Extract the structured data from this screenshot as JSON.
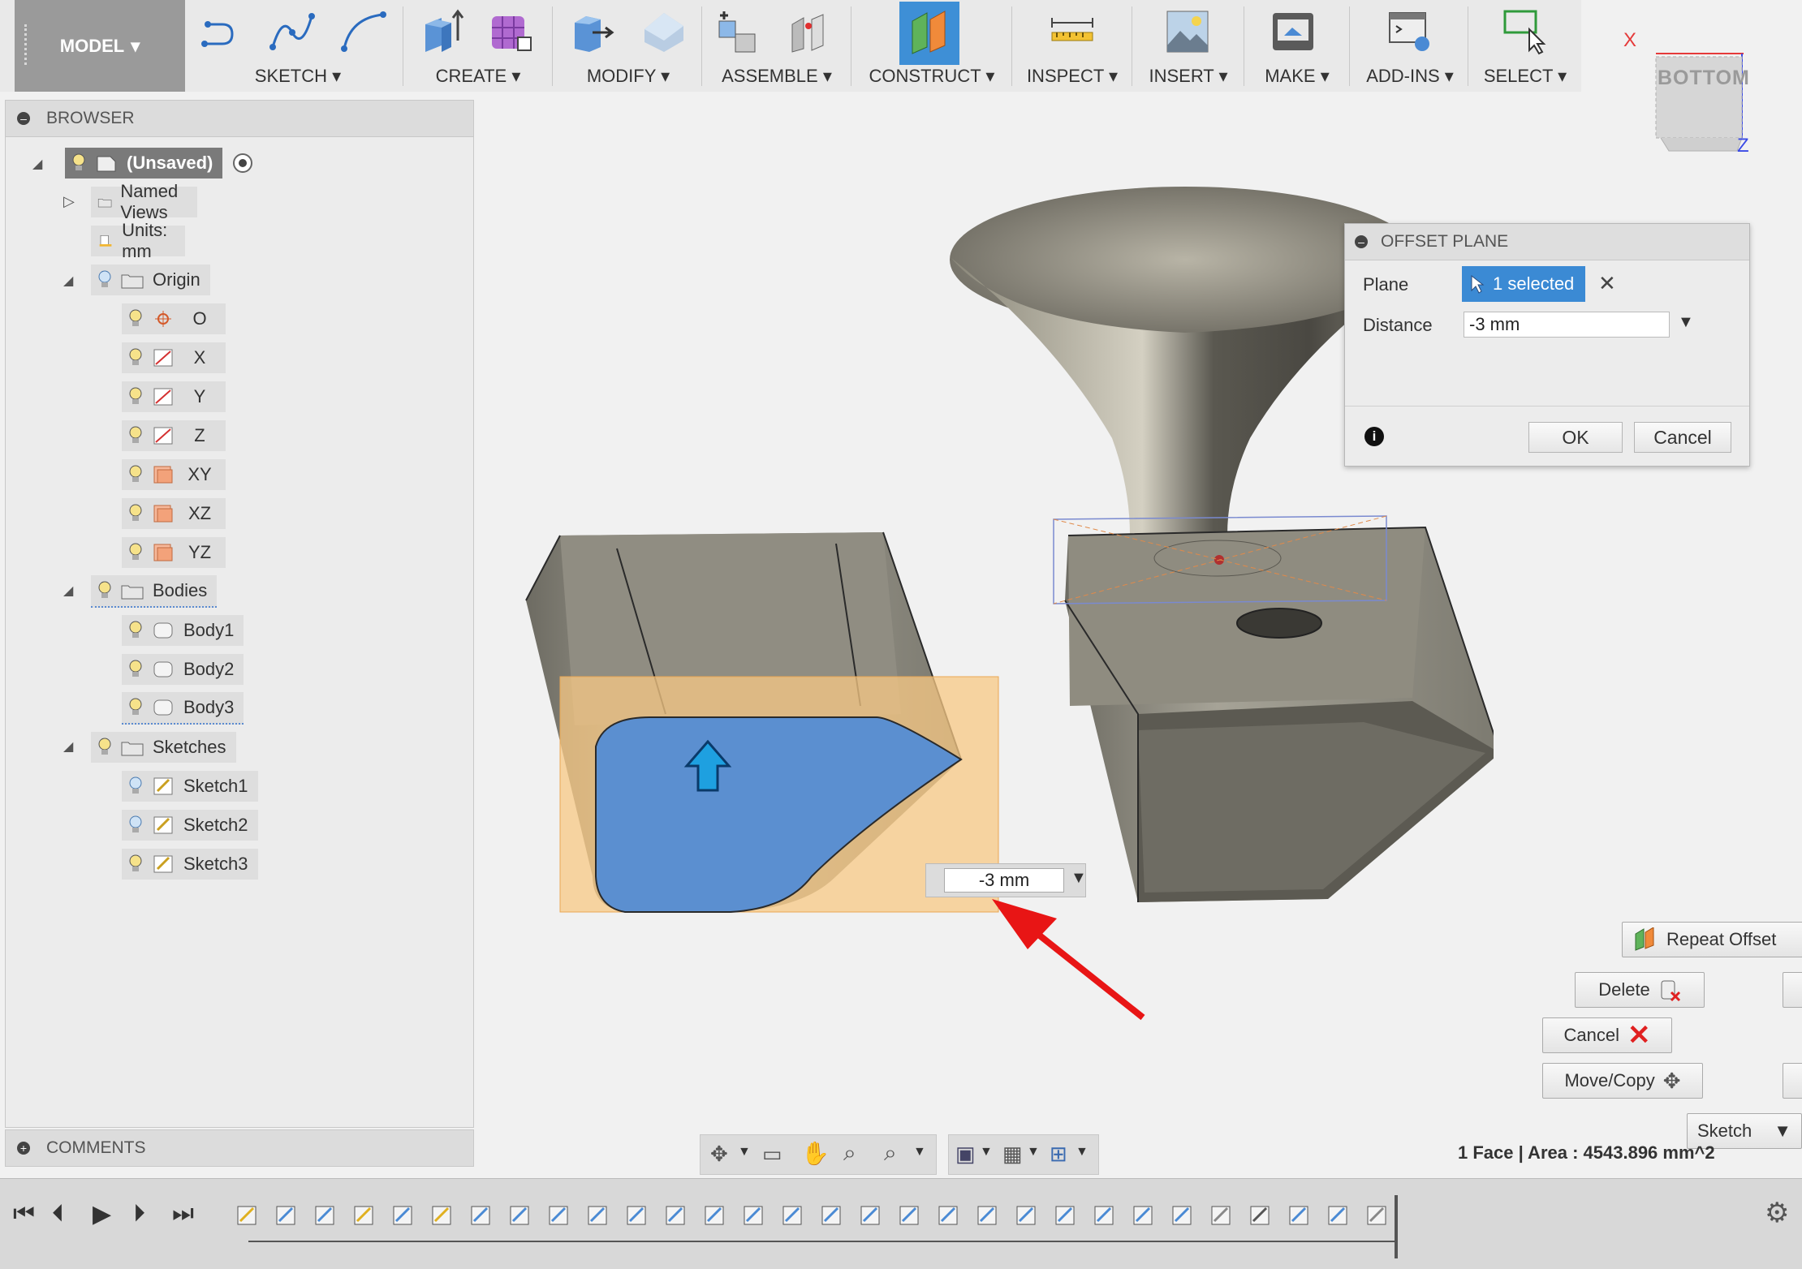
{
  "toolbar": {
    "model_label": "MODEL",
    "groups": [
      {
        "label": "SKETCH"
      },
      {
        "label": "CREATE"
      },
      {
        "label": "MODIFY"
      },
      {
        "label": "ASSEMBLE"
      },
      {
        "label": "CONSTRUCT"
      },
      {
        "label": "INSPECT"
      },
      {
        "label": "INSERT"
      },
      {
        "label": "MAKE"
      },
      {
        "label": "ADD-INS"
      },
      {
        "label": "SELECT"
      }
    ]
  },
  "viewcube": {
    "face": "BOTTOM",
    "axis_x": "X",
    "axis_z": "Z"
  },
  "browser": {
    "title": "BROWSER",
    "root": "(Unsaved)",
    "named_views": "Named Views",
    "units": "Units: mm",
    "origin": {
      "label": "Origin",
      "items": [
        "O",
        "X",
        "Y",
        "Z",
        "XY",
        "XZ",
        "YZ"
      ]
    },
    "bodies": {
      "label": "Bodies",
      "items": [
        "Body1",
        "Body2",
        "Body3"
      ]
    },
    "sketches": {
      "label": "Sketches",
      "items": [
        "Sketch1",
        "Sketch2",
        "Sketch3"
      ]
    }
  },
  "comments": {
    "title": "COMMENTS"
  },
  "dialog": {
    "title": "OFFSET PLANE",
    "plane_label": "Plane",
    "plane_value": "1 selected",
    "distance_label": "Distance",
    "distance_value": "-3 mm",
    "ok": "OK",
    "cancel": "Cancel"
  },
  "viewport": {
    "measure_value": "-3 mm"
  },
  "marking_menu": {
    "repeat": "Repeat Offset",
    "delete": "Delete",
    "cancel": "Cancel",
    "move_copy": "Move/Copy",
    "sketch": "Sketch"
  },
  "status": {
    "text": "1 Face | Area : 4543.896 mm^2"
  },
  "colors": {
    "accent": "#3b8ad4",
    "selection": "#5b8fd0",
    "plane": "#f7c884",
    "arrow": "#e81515"
  }
}
